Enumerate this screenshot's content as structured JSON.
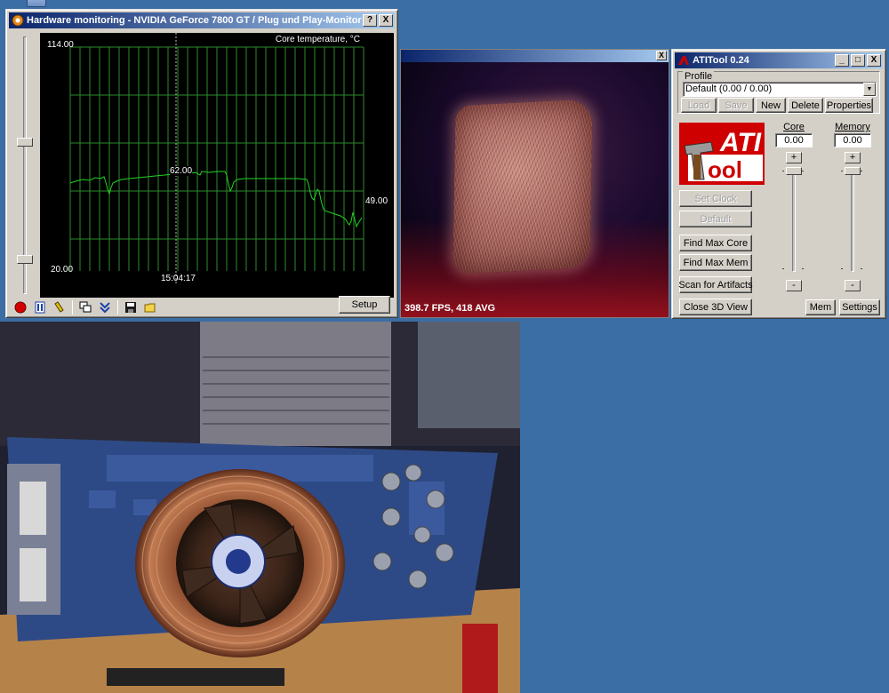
{
  "hwmon": {
    "title": "Hardware monitoring - NVIDIA GeForce 7800 GT / Plug und Play-Monitor",
    "help_btn": "?",
    "close_btn": "X",
    "setup_label": "Setup",
    "graph": {
      "label": "Core temperature, °C",
      "y_max": "114.00",
      "y_min": "20.00",
      "current_value": "49.00",
      "cursor_value": "62.00",
      "cursor_time": "15:04:17"
    }
  },
  "view3d": {
    "close_btn": "X",
    "fps_text": "398.7 FPS, 418 AVG"
  },
  "atitool": {
    "title": "ATITool 0.24",
    "minimize_btn": "_",
    "maximize_btn": "□",
    "close_btn": "X",
    "profile_label": "Profile",
    "profile_value": "Default (0.00 / 0.00)",
    "buttons": {
      "load": "Load",
      "save": "Save",
      "new": "New",
      "delete": "Delete",
      "properties": "Properties",
      "set_clock": "Set Clock",
      "default": "Default",
      "find_max_core": "Find Max Core",
      "find_max_mem": "Find Max Mem",
      "scan_artifacts": "Scan for Artifacts",
      "close_3d": "Close 3D View",
      "mem": "Mem",
      "settings": "Settings"
    },
    "core_label": "Core",
    "memory_label": "Memory",
    "core_value": "0.00",
    "memory_value": "0.00",
    "plus": "+",
    "minus": "-"
  },
  "colors": {
    "desktop": "#3a6ea5",
    "graph_line": "#22d322",
    "graph_grid": "#2e8b2e",
    "titlebar": "#0a246a",
    "ati_red": "#ce0000"
  },
  "icons": [
    "record-icon",
    "pause-icon",
    "edit-icon",
    "copy-window-icon",
    "expand-icon",
    "save-disk-icon",
    "folder-icon"
  ]
}
